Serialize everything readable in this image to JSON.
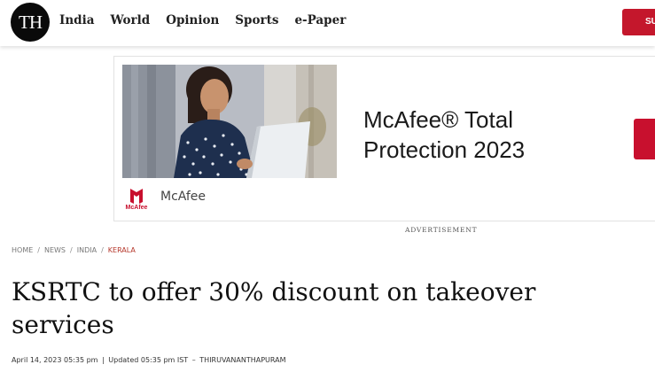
{
  "header": {
    "logo_text": "TH",
    "nav": [
      "India",
      "World",
      "Opinion",
      "Sports",
      "e-Paper"
    ],
    "subscribe_label": "SU",
    "colors": {
      "brand_red": "#c4172c",
      "logo_bg": "#0a0a0a"
    }
  },
  "ad": {
    "headline_line1": "McAfee® Total",
    "headline_line2": "Protection 2023",
    "brand_name": "McAfee",
    "brand_logo_text": "McAfee",
    "label": "ADVERTISEMENT",
    "cta_color": "#c8102e"
  },
  "breadcrumb": {
    "items": [
      "HOME",
      "NEWS",
      "INDIA",
      "KERALA"
    ],
    "separator": "/"
  },
  "article": {
    "title": "KSRTC to offer 30% discount on takeover services",
    "published": "April 14, 2023 05:35 pm",
    "updated": "Updated 05:35 pm IST",
    "location": "THIRUVANANTHAPURAM"
  }
}
